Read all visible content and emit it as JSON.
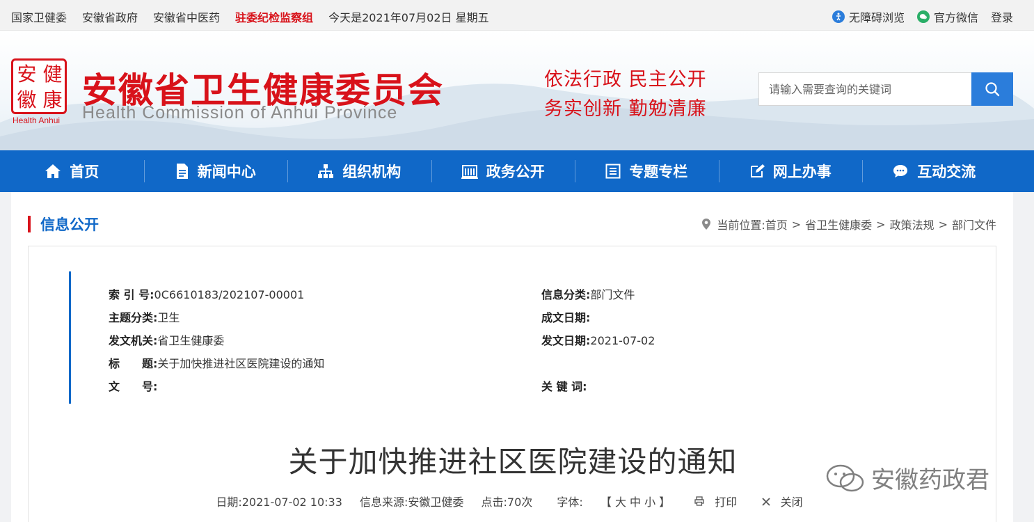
{
  "topbar": {
    "links": [
      "国家卫健委",
      "安徽省政府",
      "安徽省中医药",
      "驻委纪检监察组"
    ],
    "date_text": "今天是2021年07月02日 星期五",
    "accessibility": "无障碍浏览",
    "wechat": "官方微信",
    "login": "登录"
  },
  "header": {
    "logo_chars": [
      "安",
      "健",
      "徽",
      "康"
    ],
    "logo_sub": "Health Anhui",
    "title": "安徽省卫生健康委员会",
    "title_en": "Health Commission of Anhui Province",
    "slogan_line1": "依法行政  民主公开",
    "slogan_line2": "务实创新  勤勉清廉",
    "search_placeholder": "请输入需要查询的关键词"
  },
  "nav": [
    {
      "label": "首页",
      "icon": "home-icon"
    },
    {
      "label": "新闻中心",
      "icon": "document-icon"
    },
    {
      "label": "组织机构",
      "icon": "org-chart-icon"
    },
    {
      "label": "政务公开",
      "icon": "building-icon"
    },
    {
      "label": "专题专栏",
      "icon": "list-icon"
    },
    {
      "label": "网上办事",
      "icon": "edit-icon"
    },
    {
      "label": "互动交流",
      "icon": "chat-icon"
    }
  ],
  "section": {
    "title": "信息公开",
    "crumb_prefix": "当前位置:",
    "crumbs": [
      "首页",
      "省卫生健康委",
      "政策法规",
      "部门文件"
    ]
  },
  "meta": {
    "index_label": "索 引 号:",
    "index_value": "0C6610183/202107-00001",
    "category_label": "信息分类:",
    "category_value": "部门文件",
    "topic_label": "主题分类:",
    "topic_value": "卫生",
    "written_label": "成文日期:",
    "written_value": "",
    "issuer_label": "发文机关:",
    "issuer_value": "省卫生健康委",
    "issued_label": "发文日期:",
    "issued_value": "2021-07-02",
    "title_label": "标　　题:",
    "title_value": "关于加快推进社区医院建设的通知",
    "docno_label": "文　　号:",
    "docno_value": "",
    "keywords_label": "关 键 词:",
    "keywords_value": ""
  },
  "doc": {
    "title": "关于加快推进社区医院建设的通知",
    "date": "日期:2021-07-02 10:33",
    "source": "信息来源:安徽卫健委",
    "clicks": "点击:70次",
    "font_label": "字体:",
    "font_sizes": "【 大 中 小 】",
    "print": "打印",
    "close": "关闭"
  },
  "watermark": "安徽药政君",
  "colors": {
    "brand_red": "#d8121a",
    "nav_blue": "#1068c8",
    "search_blue": "#2b7ddb"
  }
}
